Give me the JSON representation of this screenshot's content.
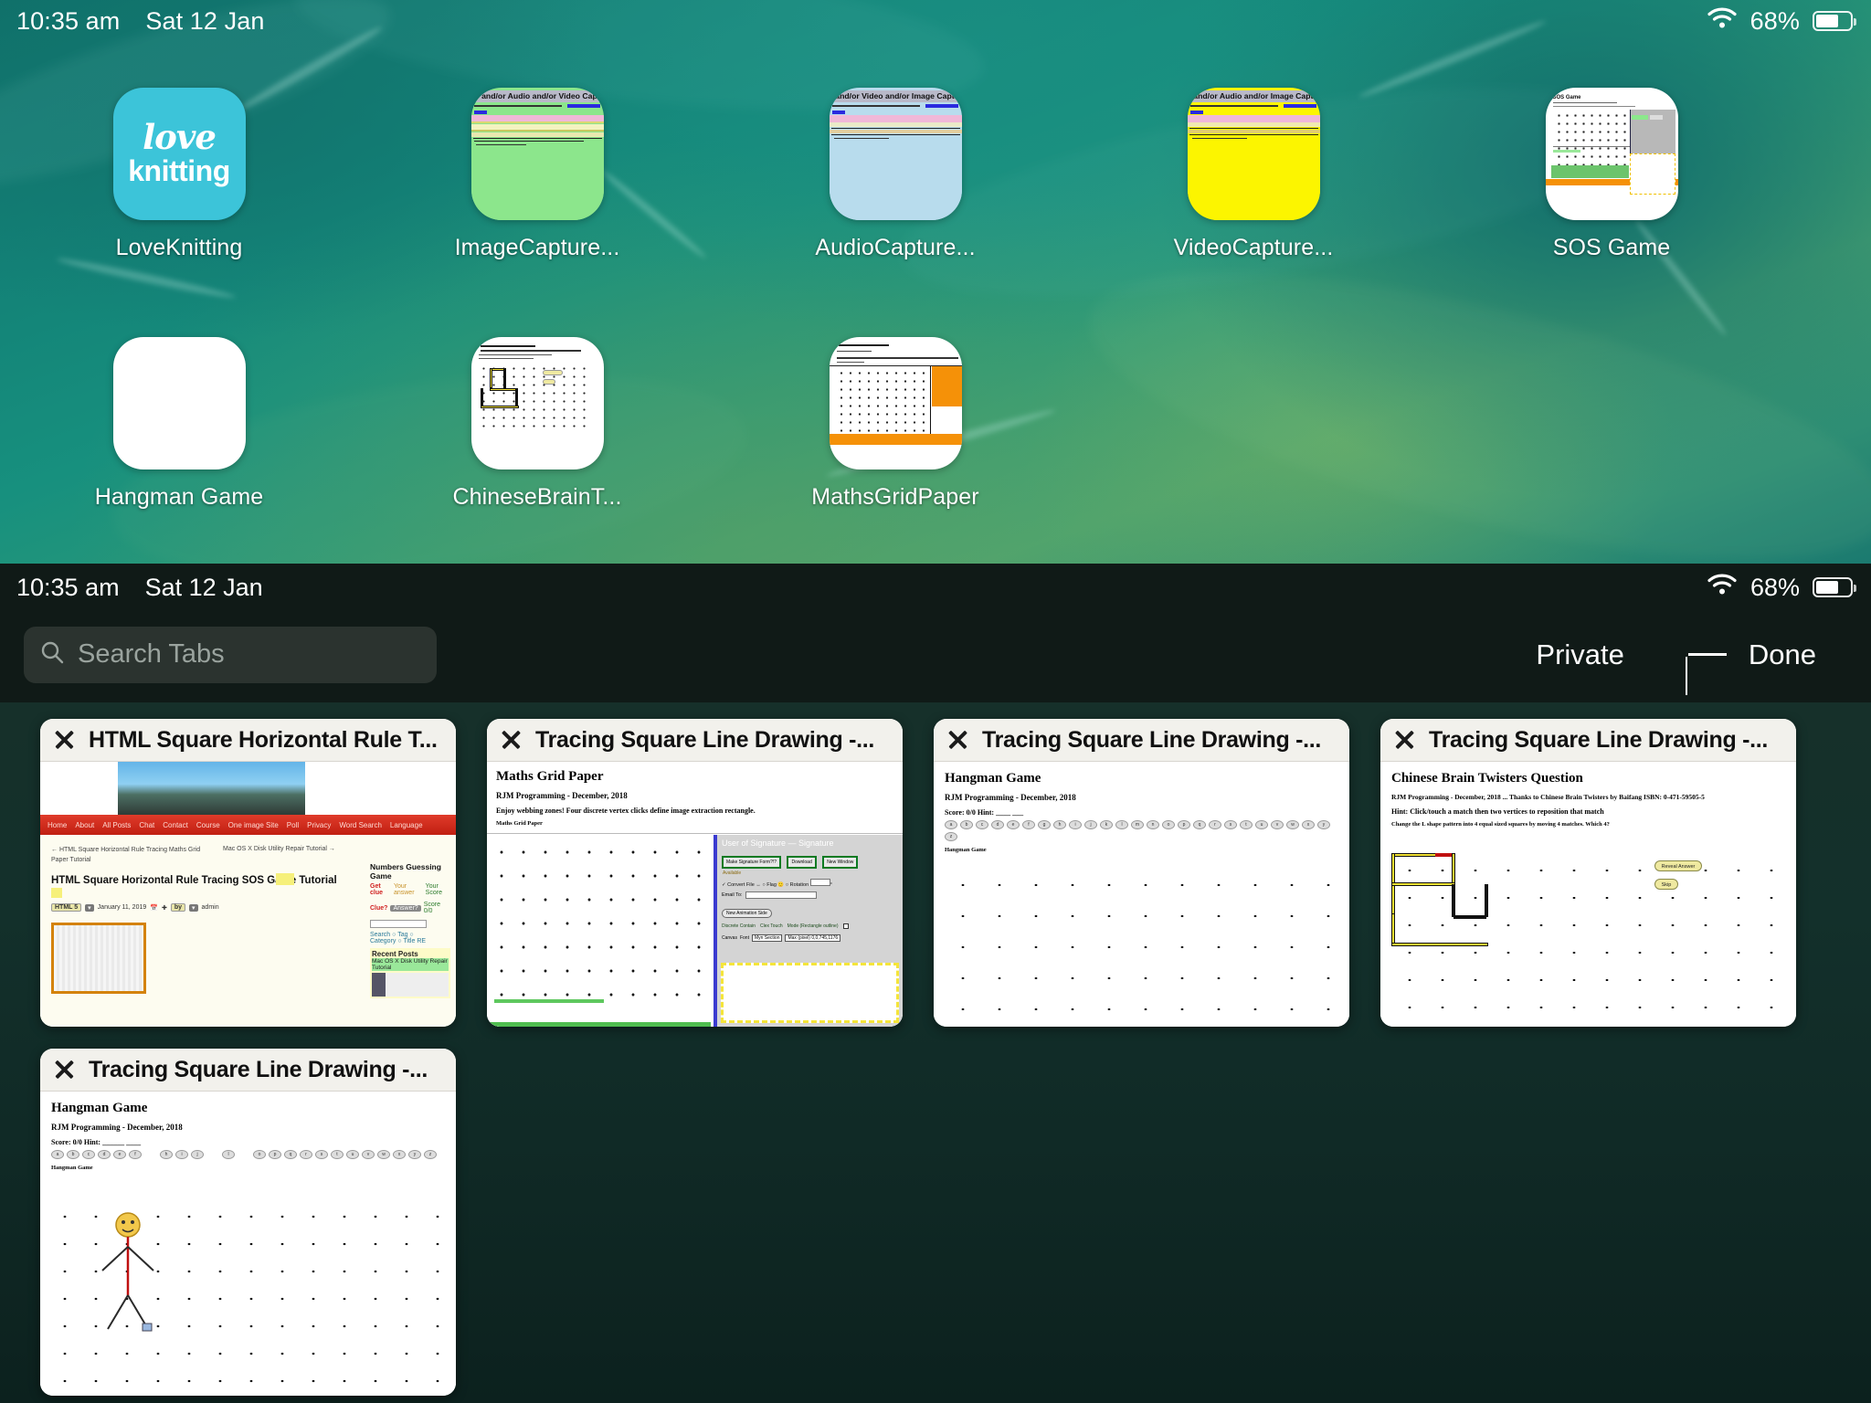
{
  "home": {
    "statusbar": {
      "time": "10:35 am",
      "date": "Sat 12 Jan",
      "battery_pct": "68%",
      "wifi_icon": "wifi-icon",
      "battery_icon": "battery-icon"
    },
    "apps_row1": [
      {
        "label": "LoveKnitting",
        "icon": "loveknitting-app-icon",
        "brand_color": "#3cc4d9",
        "logo_top": "love",
        "logo_bottom": "knitting"
      },
      {
        "label": "ImageCapture...",
        "icon": "imagecapture-app-icon",
        "page_color": "#8ce68c",
        "page_title": "ge and/or Audio and/or Video Capture Crea!"
      },
      {
        "label": "AudioCapture...",
        "icon": "audiocapture-app-icon",
        "page_color": "#b8dced",
        "page_title": "o and/or Video and/or Image Capture Crea!"
      },
      {
        "label": "VideoCapture...",
        "icon": "videocapture-app-icon",
        "page_color": "#fcf500",
        "page_title": "o and/or Audio and/or Image Capture Crea!"
      },
      {
        "label": "SOS Game",
        "icon": "sosgame-app-icon",
        "page_color": "#ffffff"
      }
    ],
    "apps_row2": [
      {
        "label": "Hangman Game",
        "icon": "hangman-app-icon",
        "page_color": "#ffffff"
      },
      {
        "label": "ChineseBrainT...",
        "icon": "chinesebrain-app-icon",
        "page_color": "#ffffff"
      },
      {
        "label": "MathsGridPaper",
        "icon": "mathsgridpaper-app-icon",
        "page_color": "#ffffff"
      }
    ]
  },
  "tabswitcher": {
    "statusbar": {
      "time": "10:35 am",
      "date": "Sat 12 Jan",
      "battery_pct": "68%"
    },
    "search": {
      "placeholder": "Search Tabs",
      "value": "",
      "icon": "search-icon"
    },
    "actions": {
      "private": "Private",
      "new_tab": "+",
      "done": "Done"
    },
    "tabs": [
      {
        "title": "HTML Square Horizontal Rule T...",
        "close_label": "×",
        "nav": [
          "Home",
          "About",
          "All Posts",
          "Chat",
          "Contact",
          "Course",
          "One image Site",
          "Poll",
          "Privacy",
          "Word Search",
          "Language"
        ],
        "prev_link": "← HTML Square Horizontal Rule Tracing Maths Grid Paper Tutorial",
        "next_link": "Mac OS X Disk Utility Repair Tutorial →",
        "heading": "HTML Square Horizontal Rule Tracing SOS Game Tutorial",
        "category_pill": "HTML 5",
        "date": "January 11, 2019",
        "by_label": "by",
        "author": "admin",
        "sidebar_title": "Numbers Guessing Game",
        "sidebar_cols": [
          "Get clue",
          "Your answer",
          "Your Score"
        ],
        "sidebar_clue": "Clue?",
        "sidebar_answer": "Answer?",
        "sidebar_score": "Score 0/0",
        "sidebar_search": "Search",
        "sidebar_tag": "Tag",
        "sidebar_category": "Category",
        "sidebar_title_re": "Title RE",
        "recent_posts": "Recent Posts",
        "recent_item": "Mac OS X Disk Utility Repair Tutorial"
      },
      {
        "title": "Tracing Square Line Drawing -...",
        "close_label": "×",
        "heading": "Maths Grid Paper",
        "byline": "RJM Programming - December, 2018",
        "intro": "Enjoy webbing zones! Four discrete vertex clicks define image extraction rectangle.",
        "subcaption": "Maths Grid Paper",
        "panel_header": "User of Signature — Signature",
        "panel_buttons": [
          "Make Signature Form?!?",
          "Download",
          "New Window"
        ],
        "panel_opts": [
          "Convert File",
          "Flag",
          "Rotation"
        ],
        "panel_email": "Email To:",
        "panel_btn2": "New Animation Side",
        "panel_row3": [
          "Discrete Contain",
          "Clex Touch",
          "Mode (Rectangle outline)"
        ],
        "panel_row4": [
          "Canvas",
          "Font",
          "Myn Section",
          "Max (pixel) 0,0,745,1176"
        ]
      },
      {
        "title": "Tracing Square Line Drawing -...",
        "close_label": "×",
        "heading": "Hangman Game",
        "byline": "RJM Programming - December, 2018",
        "score": "Score: 0/0 Hint: ____ ___",
        "letters": [
          "a",
          "b",
          "c",
          "d",
          "e",
          "f",
          "g",
          "h",
          "i",
          "j",
          "k",
          "l",
          "m",
          "n",
          "o",
          "p",
          "q",
          "r",
          "s",
          "t",
          "u",
          "v",
          "w",
          "x",
          "y",
          "z"
        ],
        "caption": "Hangman Game"
      },
      {
        "title": "Tracing Square Line Drawing -...",
        "close_label": "×",
        "heading": "Chinese Brain Twisters Question",
        "byline": "RJM Programming - December, 2018 ... Thanks to Chinese Brain Twisters by Baifang ISBN: 0-471-59505-5",
        "hint": "Hint: Click/touch a match then two vertices to reposition that match",
        "question": "Change the L shape pattern into 4 equal sized squares by moving 4 matches. Which 4?",
        "btn_reveal": "Reveal Answer",
        "btn_skip": "Skip"
      },
      {
        "title": "Tracing Square Line Drawing -...",
        "close_label": "×",
        "heading": "Hangman Game",
        "byline": "RJM Programming - December, 2018",
        "score": "Score: 0/0 Hint: ______ ____",
        "letters": [
          "a",
          "b",
          "c",
          "d",
          "e",
          "f",
          "h",
          "i",
          "j",
          "l",
          "o",
          "p",
          "q",
          "r",
          "s",
          "t",
          "u",
          "v",
          "w",
          "x",
          "y",
          "z"
        ],
        "caption": "Hangman Game"
      }
    ]
  }
}
